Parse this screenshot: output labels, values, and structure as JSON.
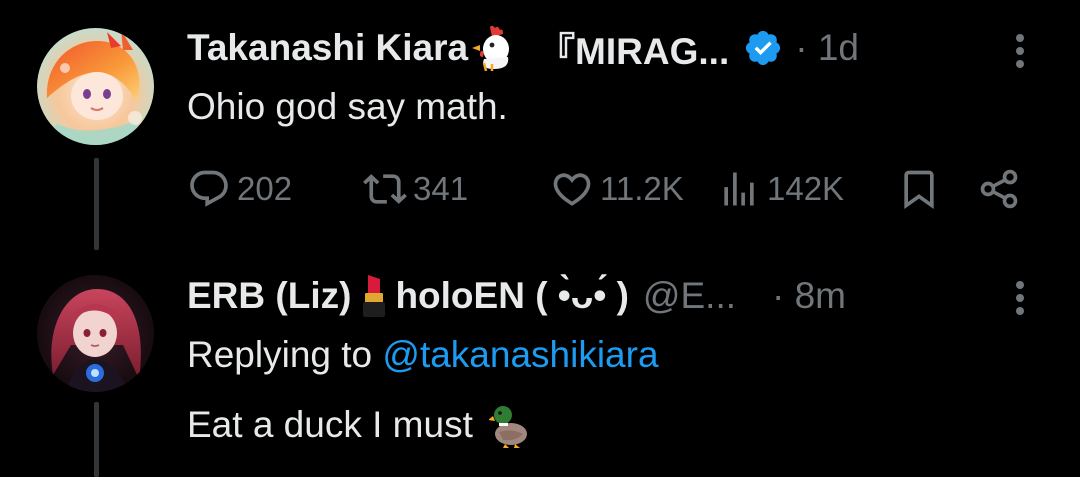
{
  "colors": {
    "background": "#000000",
    "text": "#e7e9ea",
    "muted": "#71767b",
    "link": "#1d9bf0",
    "verified": "#1d9bf0",
    "thread_line": "#333639"
  },
  "tweet": {
    "author_name": "Takanashi Kiara",
    "author_emoji": "🐔",
    "author_suffix": "『MIRAG...",
    "verified_icon": "verified-badge-icon",
    "time": "· 1d",
    "text": "Ohio god say math.",
    "stats": {
      "replies": "202",
      "reposts": "341",
      "likes": "11.2K",
      "views": "142K"
    },
    "icons": [
      "reply-icon",
      "repost-icon",
      "like-icon",
      "views-icon",
      "bookmark-icon",
      "share-icon",
      "more-icon"
    ]
  },
  "reply": {
    "author_name": "ERB (Liz)",
    "author_emoji": "💄",
    "author_suffix": "holoEN ( •̀ᴗ•́ )",
    "handle": "@E...",
    "time": "· 8m",
    "replying_prefix": "Replying to",
    "replying_to": "@takanashikiara",
    "text": "Eat a duck I must",
    "text_emoji": "🦆"
  }
}
